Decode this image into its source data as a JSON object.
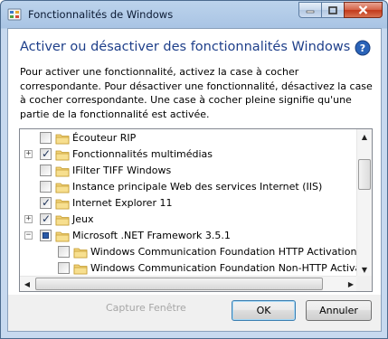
{
  "window": {
    "title": "Fonctionnalités de Windows",
    "buttons": {
      "minimize_icon": "minimize-icon",
      "maximize_icon": "maximize-icon",
      "close_icon": "close-icon"
    }
  },
  "heading": "Activer ou désactiver des fonctionnalités Windows",
  "description": "Pour activer une fonctionnalité, activez la case à cocher correspondante. Pour désactiver une fonctionnalité, désactivez la case à cocher correspondante. Une case à cocher pleine signifie qu'une partie de la fonctionnalité est activée.",
  "features": [
    {
      "label": "Écouteur RIP",
      "checked": false,
      "expander": "",
      "level": 0
    },
    {
      "label": "Fonctionnalités multimédias",
      "checked": true,
      "expander": "+",
      "level": 0
    },
    {
      "label": "IFilter TIFF Windows",
      "checked": false,
      "expander": "",
      "level": 0
    },
    {
      "label": "Instance principale Web des services Internet (IIS)",
      "checked": false,
      "expander": "",
      "level": 0
    },
    {
      "label": "Internet Explorer 11",
      "checked": true,
      "expander": "",
      "level": 0
    },
    {
      "label": "Jeux",
      "checked": true,
      "expander": "+",
      "level": 0
    },
    {
      "label": "Microsoft .NET Framework 3.5.1",
      "checked": "partial",
      "expander": "−",
      "level": 0
    },
    {
      "label": "Windows Communication Foundation HTTP Activation",
      "checked": false,
      "expander": "",
      "level": 1
    },
    {
      "label": "Windows Communication Foundation Non-HTTP Activa",
      "checked": false,
      "expander": "",
      "level": 1
    }
  ],
  "capture_text": "Capture Fenêtre",
  "ok_label": "OK",
  "cancel_label": "Annuler",
  "colors": {
    "heading": "#1e3f8a",
    "window_frame": "#a9c4e4",
    "close_button": "#c2391a"
  }
}
